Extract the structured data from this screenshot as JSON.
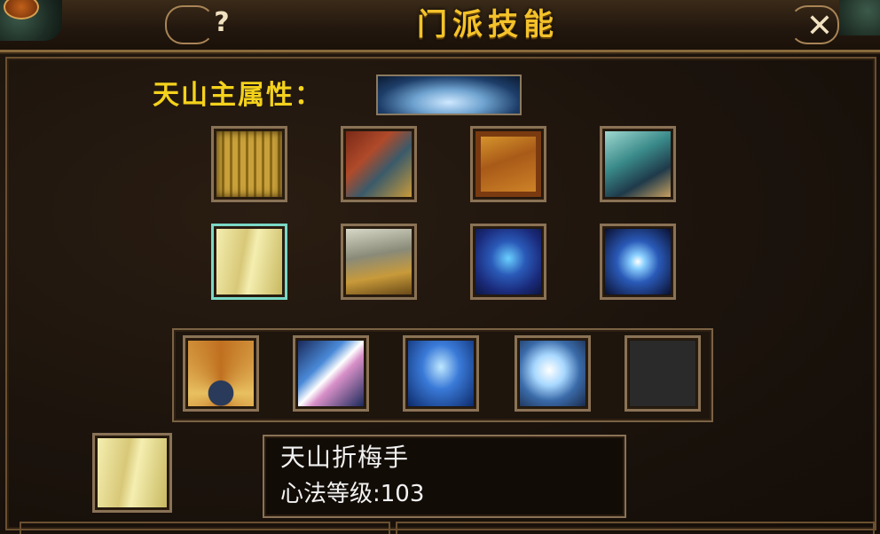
{
  "window": {
    "title": "门派技能",
    "help_label": "?",
    "close_label": "✕"
  },
  "attribute": {
    "label": "天山主属性："
  },
  "row1_icons": [
    "scroll-icon",
    "red-chest-book-icon",
    "gold-book-icon",
    "teal-book-icon"
  ],
  "row2_icons": [
    "open-manual-icon",
    "bound-book-icon",
    "blue-talisman-icon",
    "galaxy-swirl-icon"
  ],
  "tray_icons": [
    "golden-fan-icon",
    "blossom-strike-icon",
    "blue-whirlwind-icon",
    "ice-palm-icon",
    "empty-slot"
  ],
  "selected": {
    "skill_name": "天山折梅手",
    "level_text": "心法等级:103"
  },
  "colors": {
    "title": "#f4c22a",
    "label": "#f4d21c",
    "selected_border": "#7ad8c6"
  }
}
